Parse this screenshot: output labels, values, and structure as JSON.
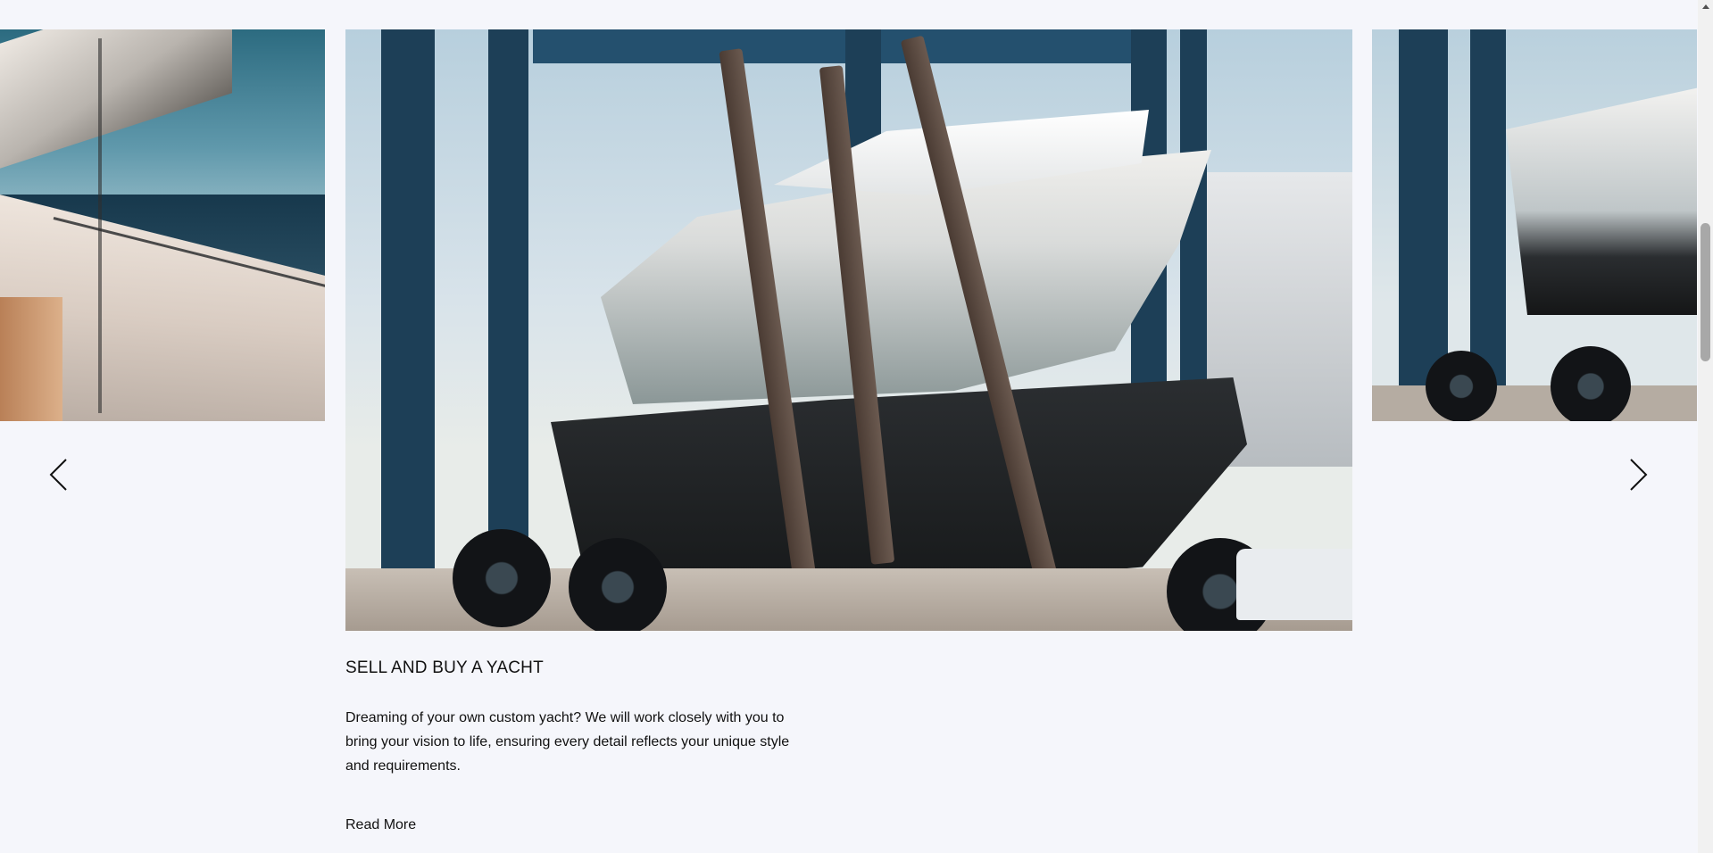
{
  "slide": {
    "title": "SELL AND BUY A YACHT",
    "description": "Dreaming of your own custom yacht? We will work closely with you to bring your vision to life, ensuring every detail reflects your unique style and requirements.",
    "read_more_label": "Read More"
  },
  "carousel": {
    "prev_icon": "chevron-left-icon",
    "next_icon": "chevron-right-icon"
  },
  "colors": {
    "background": "#f5f6fb",
    "text": "#111111",
    "scrollbar_thumb": "#a8a8a8"
  }
}
